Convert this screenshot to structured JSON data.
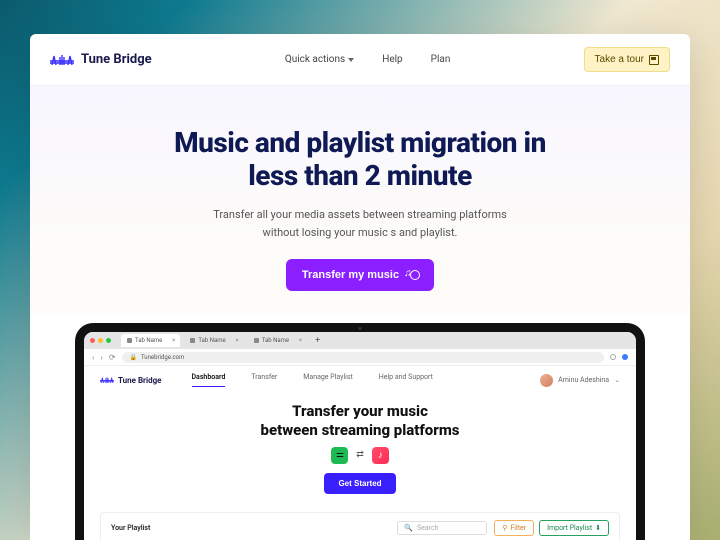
{
  "brand": {
    "name": "Tune Bridge"
  },
  "nav": {
    "quick_actions": "Quick actions",
    "help": "Help",
    "plan": "Plan",
    "tour": "Take a tour"
  },
  "hero": {
    "title_l1": "Music and playlist migration in",
    "title_l2": "less than 2 minute",
    "sub_l1": "Transfer all your media assets between streaming platforms",
    "sub_l2": "without losing your music s and playlist.",
    "cta": "Transfer my music"
  },
  "browser": {
    "tabs": [
      {
        "label": "Tab Name"
      },
      {
        "label": "Tab Name"
      },
      {
        "label": "Tab Name"
      }
    ],
    "url": "Tunebridge.com"
  },
  "app": {
    "brand": "Tune Bridge",
    "tabs": {
      "dashboard": "Dashboard",
      "transfer": "Transfer",
      "manage": "Manage Playlist",
      "help": "Help and Support"
    },
    "user": "Aminu Adeshina",
    "hero_l1": "Transfer your music",
    "hero_l2": "between streaming platforms",
    "cta": "Get Started",
    "playlist": {
      "title": "Your Playlist",
      "search_placeholder": "Search",
      "filter": "Filter",
      "import": "Import Playlist"
    }
  },
  "icons": {
    "spotify": "spotify-icon",
    "swap": "swap-icon",
    "apple_music": "apple-music-icon"
  },
  "colors": {
    "primary_purple": "#8b1fff",
    "app_primary": "#3a1fff",
    "tour_bg": "#fff3c6"
  }
}
